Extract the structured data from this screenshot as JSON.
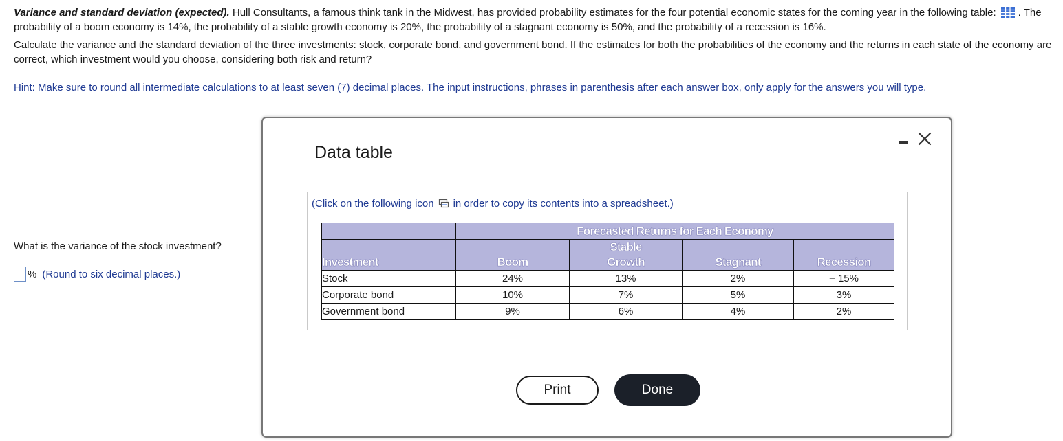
{
  "problem": {
    "title": "Variance and standard deviation (expected).",
    "intro_a": " Hull Consultants, a famous think tank in the Midwest, has provided probability estimates for the four potential economic states for the coming year in the following table:",
    "intro_b": ". The probability of a boom economy is 14%, the probability of a stable growth economy is 20%, the probability of a stagnant economy is 50%, and the probability of a recession is 16%.",
    "para2": "Calculate the variance and the standard deviation of the three investments: stock, corporate bond, and government bond.  If the estimates for both the probabilities of the economy and the returns in each state of the economy are correct, which investment would you choose, considering both risk and return?",
    "hint": "Hint: Make sure to round all intermediate calculations to at least seven (7) decimal places. The input instructions, phrases in parenthesis after each answer box, only apply for the answers you will type."
  },
  "question": {
    "text": "What is the variance of the stock investment?",
    "unit": "%",
    "instruction": "(Round to six decimal places.)",
    "value": ""
  },
  "modal": {
    "title": "Data table",
    "copy_before": "(Click on the following icon",
    "copy_after": "in order to copy its contents into a spreadsheet.)",
    "table": {
      "group_header": "Forecasted Returns for Each Economy",
      "columns": [
        "Investment",
        "Boom",
        "Stable",
        "Growth",
        "Stagnant",
        "Recession"
      ],
      "rows": [
        {
          "name": "Stock",
          "values": [
            "24%",
            "13%",
            "2%",
            "− 15%"
          ]
        },
        {
          "name": "Corporate bond",
          "values": [
            "10%",
            "7%",
            "5%",
            "3%"
          ]
        },
        {
          "name": "Government bond",
          "values": [
            "9%",
            "6%",
            "4%",
            "2%"
          ]
        }
      ]
    },
    "print_label": "Print",
    "done_label": "Done"
  },
  "icons": {
    "table_icon": "grid-table-icon",
    "copy_icon": "copy-spreadsheet-icon",
    "minimize_icon": "minimize-icon",
    "close_icon": "close-icon"
  },
  "colors": {
    "header_fill": "#b5b5dc",
    "hint_text": "#1f3a93",
    "done_button": "#1b2029",
    "table_icon": "#3b6fd4"
  }
}
